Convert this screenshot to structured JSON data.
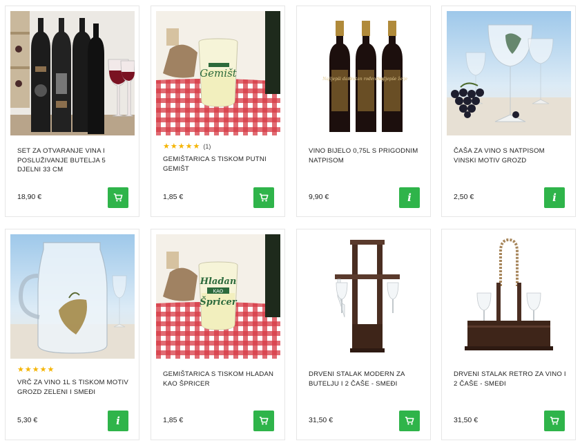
{
  "products": [
    {
      "title": "SET ZA OTVARANJE VINA I POSLUŽIVANJE BUTELJA 5 DJELNI 33 CM",
      "price": "18,90 €",
      "action": "cart",
      "stars": 0,
      "reviews": ""
    },
    {
      "title": "GEMIŠTARICA S TISKOM PUTNI GEMIŠT",
      "price": "1,85 €",
      "action": "cart",
      "stars": 5,
      "reviews": "(1)"
    },
    {
      "title": "VINO BIJELO 0,75L S PRIGODNIM NATPISOM",
      "price": "9,90 €",
      "action": "info",
      "stars": 0,
      "reviews": ""
    },
    {
      "title": "ČAŠA ZA VINO S NATPISOM VINSKI MOTIV GROZD",
      "price": "2,50 €",
      "action": "info",
      "stars": 0,
      "reviews": ""
    },
    {
      "title": "VRČ ZA VINO 1L S TISKOM MOTIV GROZD ZELENI I SMEĐI",
      "price": "5,30 €",
      "action": "info",
      "stars": 5,
      "reviews": ""
    },
    {
      "title": "GEMIŠTARICA S TISKOM HLADAN KAO ŠPRICER",
      "price": "1,85 €",
      "action": "cart",
      "stars": 0,
      "reviews": ""
    },
    {
      "title": "DRVENI STALAK MODERN ZA BUTELJU I 2 ČAŠE - smeđi",
      "price": "31,50 €",
      "action": "cart",
      "stars": 0,
      "reviews": ""
    },
    {
      "title": "DRVENI STALAK RETRO ZA VINO I 2 ČAŠE - smeđi",
      "price": "31,50 €",
      "action": "cart",
      "stars": 0,
      "reviews": ""
    }
  ],
  "image_texts": {
    "gemist_glass": "Gemišt",
    "bottle_labels": [
      "Najljepši dani ...",
      "Sretan rođendan",
      "Najljepše želje"
    ],
    "spricer_glass_top": "Hladan",
    "spricer_glass_mid": "KAO",
    "spricer_glass_bottom": "Špricer"
  },
  "icons": {
    "cart": "cart-icon",
    "info": "info-icon"
  },
  "colors": {
    "button": "#2fb44a",
    "star": "#f5b400",
    "border": "#e6e6e6"
  }
}
